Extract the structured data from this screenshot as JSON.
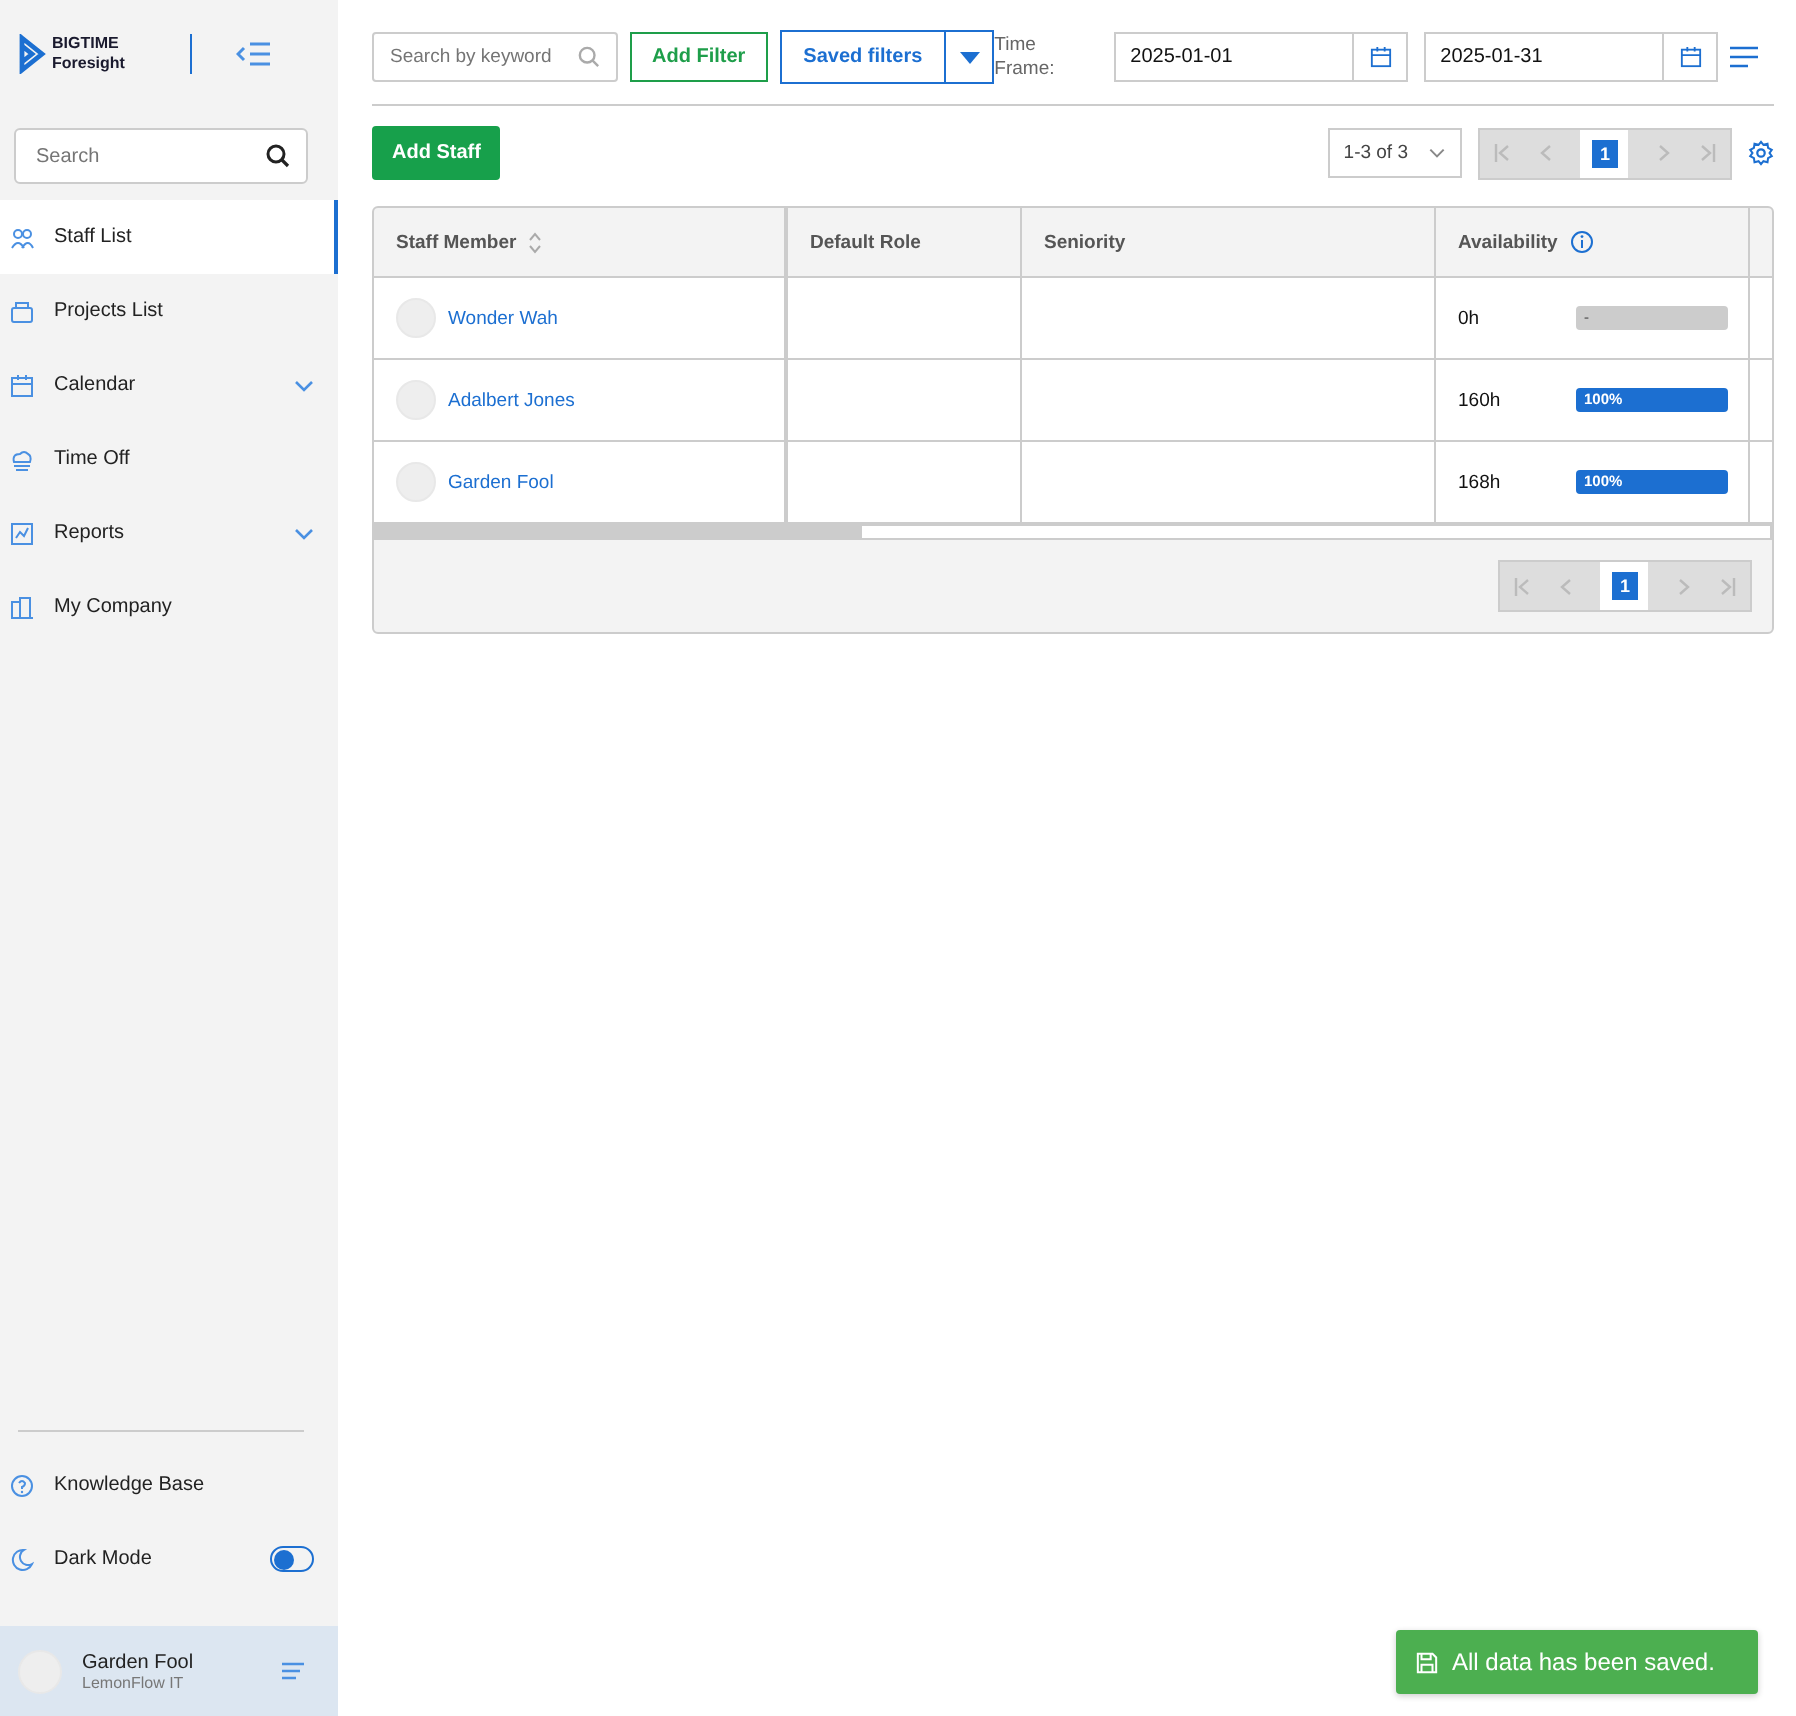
{
  "sidebar": {
    "logo": {
      "line1": "BIGTIME",
      "line2": "Foresight"
    },
    "search": {
      "placeholder": "Search"
    },
    "items": [
      {
        "label": "Staff List",
        "selected": true,
        "expandable": false
      },
      {
        "label": "Projects List",
        "selected": false,
        "expandable": false
      },
      {
        "label": "Calendar",
        "selected": false,
        "expandable": true
      },
      {
        "label": "Time Off",
        "selected": false,
        "expandable": false
      },
      {
        "label": "Reports",
        "selected": false,
        "expandable": true
      },
      {
        "label": "My Company",
        "selected": false,
        "expandable": false
      }
    ],
    "knowledge_base": "Knowledge Base",
    "dark_mode": {
      "label": "Dark Mode",
      "on": false
    },
    "user": {
      "name": "Garden Fool",
      "company": "LemonFlow IT"
    }
  },
  "toolbar": {
    "search": {
      "placeholder": "Search by keyword"
    },
    "add_filter": "Add Filter",
    "saved_filters": "Saved filters",
    "time_frame_label": "Time Frame:",
    "date_from": "2025-01-01",
    "date_to": "2025-01-31"
  },
  "add_staff": "Add Staff",
  "page_range": "1-3 of 3",
  "page": "1",
  "table": {
    "columns": [
      "Staff Member",
      "Default Role",
      "Seniority",
      "Availability"
    ],
    "rows": [
      {
        "name": "Wonder Wah",
        "hours": "0h",
        "level": 0,
        "bar_label": "-"
      },
      {
        "name": "Adalbert Jones",
        "hours": "160h",
        "level": 1,
        "bar_label": "100%"
      },
      {
        "name": "Garden Fool",
        "hours": "168h",
        "level": 1,
        "bar_label": "100%"
      }
    ],
    "page": "1"
  },
  "toast": "All data has been saved."
}
